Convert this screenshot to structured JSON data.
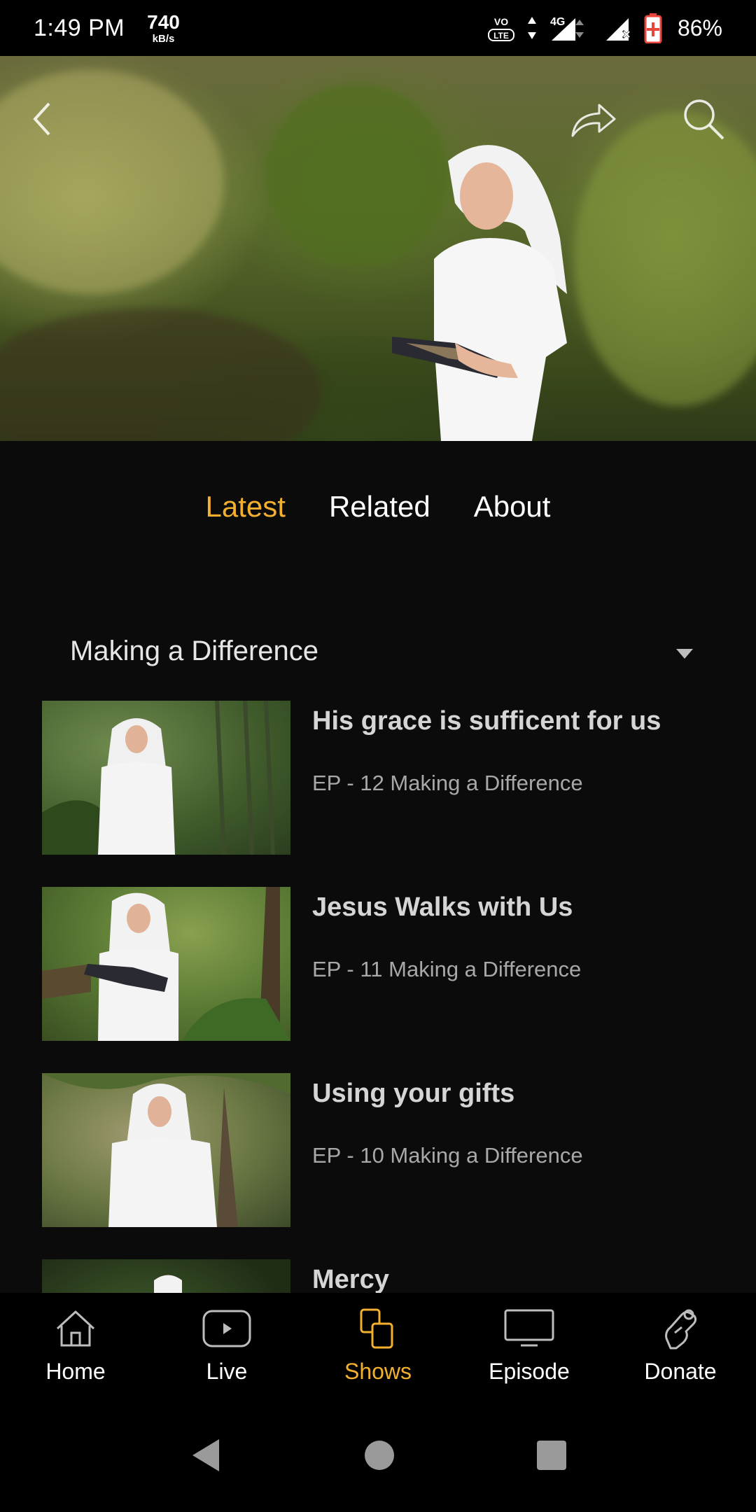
{
  "status_bar": {
    "time": "1:49 PM",
    "speed_value": "740",
    "speed_unit": "kB/s",
    "network": "4G",
    "volte": "VO LTE",
    "battery": "86%"
  },
  "hero": {
    "back_icon": "chevron-left-icon",
    "share_icon": "share-arrow-icon",
    "search_icon": "search-icon"
  },
  "tabs": [
    {
      "label": "Latest",
      "active": true
    },
    {
      "label": "Related",
      "active": false
    },
    {
      "label": "About",
      "active": false
    }
  ],
  "season": {
    "selected": "Making a Difference"
  },
  "episodes": [
    {
      "title": "His grace is sufficent for us",
      "subtitle": "EP - 12 Making a Difference"
    },
    {
      "title": "Jesus Walks with Us",
      "subtitle": "EP - 11 Making a Difference"
    },
    {
      "title": "Using your gifts",
      "subtitle": "EP - 10 Making a Difference"
    },
    {
      "title": "Mercy",
      "subtitle": ""
    }
  ],
  "bottom_nav": [
    {
      "label": "Home",
      "icon": "home-icon",
      "active": false
    },
    {
      "label": "Live",
      "icon": "play-screen-icon",
      "active": false
    },
    {
      "label": "Shows",
      "icon": "shows-icon",
      "active": true
    },
    {
      "label": "Episode",
      "icon": "monitor-icon",
      "active": false
    },
    {
      "label": "Donate",
      "icon": "donate-hand-icon",
      "active": false
    }
  ],
  "colors": {
    "accent": "#f3b02e",
    "background": "#0b0b0b",
    "nav_background": "#000000"
  }
}
